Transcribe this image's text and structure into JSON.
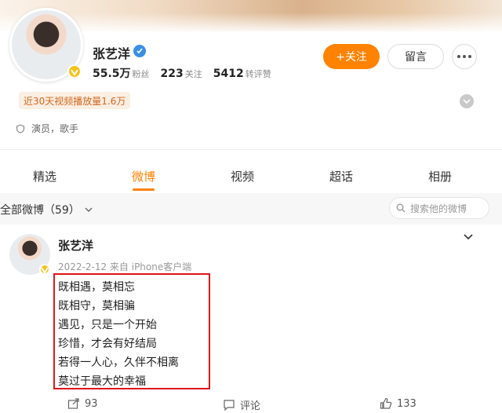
{
  "profile": {
    "name": "张艺洋",
    "stats": [
      {
        "num": "55.5万",
        "label": "粉丝"
      },
      {
        "num": "223",
        "label": "关注"
      },
      {
        "num": "5412",
        "label": "转评赞"
      }
    ],
    "views_badge": "近30天视频播放量1.6万",
    "bio": "演员，歌手"
  },
  "buttons": {
    "follow": "+关注",
    "message": "留言"
  },
  "tabs": [
    "精选",
    "微博",
    "视频",
    "超话",
    "相册"
  ],
  "active_tab": "微博",
  "filter": {
    "label": "全部微博（59）",
    "search_placeholder": "搜索他的微博"
  },
  "post": {
    "author": "张艺洋",
    "meta": "2022-2-12 来自 iPhone客户端",
    "lines": [
      "既相遇，莫相忘",
      "既相守，莫相骗",
      "遇见，只是一个开始",
      "珍惜，才会有好结局",
      "若得一人心，久伴不相离",
      "莫过于最大的幸福"
    ],
    "actions": {
      "repost": "93",
      "comment": "评论",
      "like": "133"
    }
  },
  "colors": {
    "accent": "#ff8200",
    "highlight_box": "#e0151b",
    "verified": "#3a8ee6",
    "badge": "#f7c21a"
  }
}
